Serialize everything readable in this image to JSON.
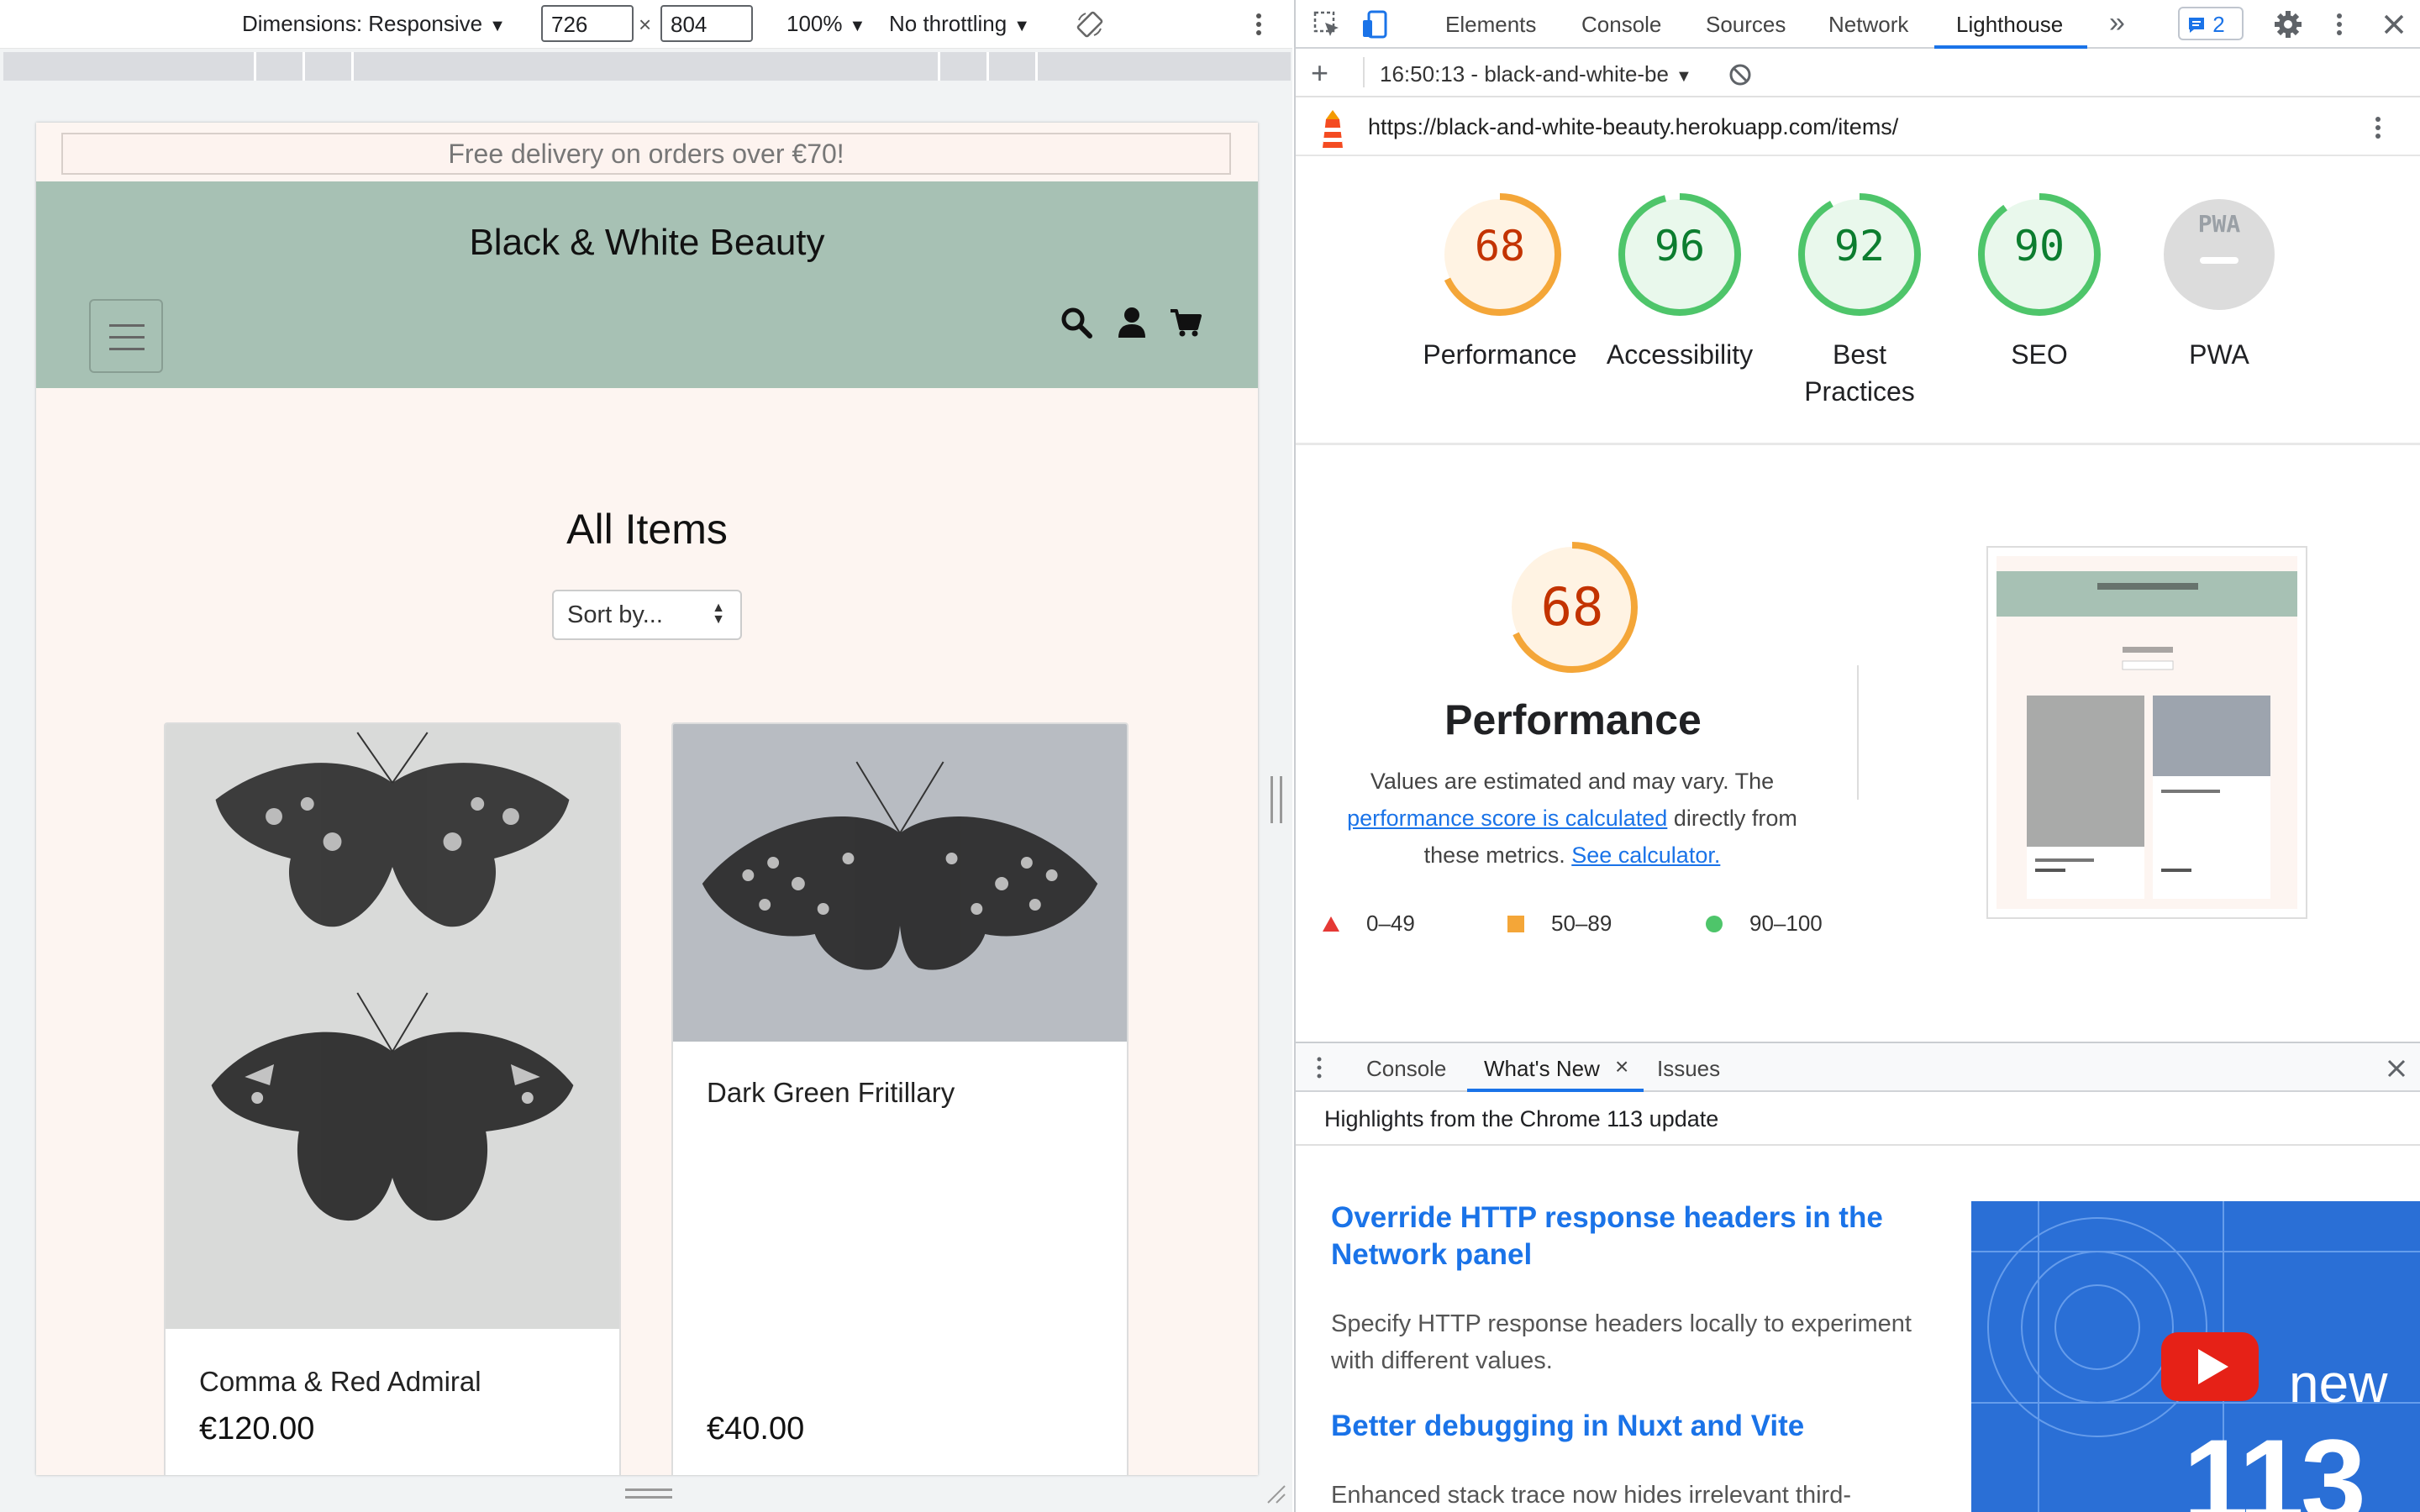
{
  "device_toolbar": {
    "dimensions_label": "Dimensions: Responsive",
    "width": "726",
    "height": "804",
    "times": "×",
    "zoom": "100%",
    "throttling": "No throttling"
  },
  "site": {
    "delivery_banner": "Free delivery on orders over €70!",
    "brand": "Black & White Beauty",
    "page_title": "All Items",
    "sort_label": "Sort by...",
    "products": [
      {
        "name": "Comma & Red Admiral",
        "price": "€120.00"
      },
      {
        "name": "Dark Green Fritillary",
        "price": "€40.00"
      }
    ],
    "colors": {
      "header_bg": "#a7c1b4",
      "page_bg": "#fdf5f1"
    }
  },
  "devtools": {
    "tabs": [
      "Elements",
      "Console",
      "Sources",
      "Network",
      "Lighthouse"
    ],
    "active_tab": "Lighthouse",
    "issues_count": "2",
    "report_time": "16:50:13 - black-and-white-be",
    "url": "https://black-and-white-beauty.herokuapp.com/items/",
    "scores": [
      {
        "label": "Performance",
        "score": "68",
        "value": 0.68,
        "color": "#c33300",
        "ring": "#f4a638",
        "fill": "#fff3e3"
      },
      {
        "label": "Accessibility",
        "score": "96",
        "value": 0.96,
        "color": "#0c7d2f",
        "ring": "#4ec56a",
        "fill": "#e9f8ec"
      },
      {
        "label": "Best Practices",
        "score": "92",
        "value": 0.92,
        "color": "#0c7d2f",
        "ring": "#4ec56a",
        "fill": "#e9f8ec"
      },
      {
        "label": "SEO",
        "score": "90",
        "value": 0.9,
        "color": "#0c7d2f",
        "ring": "#4ec56a",
        "fill": "#e9f8ec"
      },
      {
        "label": "PWA",
        "score": "PWA",
        "value": 0,
        "color": "#9aa0a6",
        "ring": "#dcdcdc",
        "fill": "#dcdcdc"
      }
    ],
    "performance": {
      "score": "68",
      "title": "Performance",
      "desc_prefix": "Values are estimated and may vary. The ",
      "desc_link": "performance score is calculated",
      "desc_mid": " directly from these metrics.",
      "desc_calc": "See calculator.",
      "legend": [
        {
          "range": "0–49",
          "color": "#e53935"
        },
        {
          "range": "50–89",
          "color": "#f4a638"
        },
        {
          "range": "90–100",
          "color": "#4ec56a"
        }
      ]
    },
    "drawer": {
      "tabs": [
        "Console",
        "What's New",
        "Issues"
      ],
      "active_tab": "What's New",
      "highlights": "Highlights from the Chrome 113 update",
      "items": [
        {
          "title": "Override HTTP response headers in the Network panel",
          "desc": "Specify HTTP response headers locally to experiment with different values."
        },
        {
          "title": "Better debugging in Nuxt and Vite",
          "desc": "Enhanced stack trace now hides irrelevant third-"
        }
      ],
      "promo_text": "new",
      "promo_number": "113"
    }
  }
}
